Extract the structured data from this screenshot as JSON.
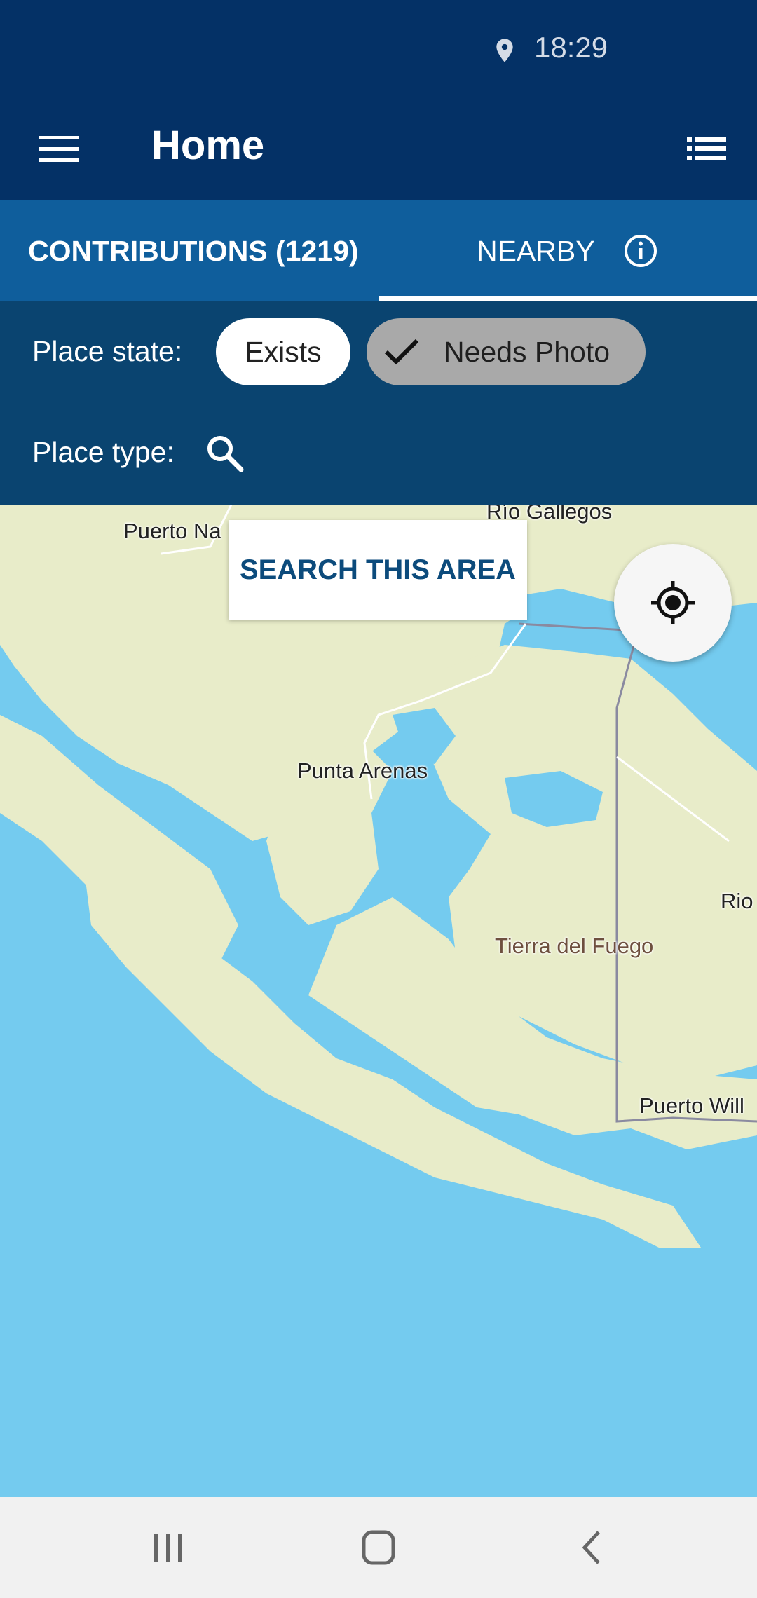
{
  "status_bar": {
    "time": "18:29",
    "location_icon": "location-pin-icon"
  },
  "app_bar": {
    "title": "Home",
    "menu_icon": "hamburger-menu-icon",
    "list_icon": "list-view-icon"
  },
  "tabs": [
    {
      "label": "CONTRIBUTIONS (1219)",
      "selected": false
    },
    {
      "label": "NEARBY",
      "selected": true
    }
  ],
  "filters": {
    "place_state_label": "Place state:",
    "state_chips": [
      {
        "label": "Exists",
        "checked": false
      },
      {
        "label": "Needs Photo",
        "checked": true
      }
    ],
    "place_type_label": "Place type:"
  },
  "map": {
    "search_area_label": "SEARCH THIS AREA",
    "locate_icon": "my-location-icon",
    "places": [
      "Puerto Na",
      "Río Gallegos",
      "Punta Arenas",
      "Rio",
      "Tierra del Fuego",
      "Puerto Will"
    ]
  },
  "colors": {
    "app_bar": "#043166",
    "tab_bar": "#0f5e9c",
    "filter_panel": "#0a4470",
    "water": "#74cbef",
    "land": "#e8ecc9"
  },
  "nav_bar": {
    "recent_icon": "recent-apps-icon",
    "home_icon": "home-icon",
    "back_icon": "back-icon"
  }
}
